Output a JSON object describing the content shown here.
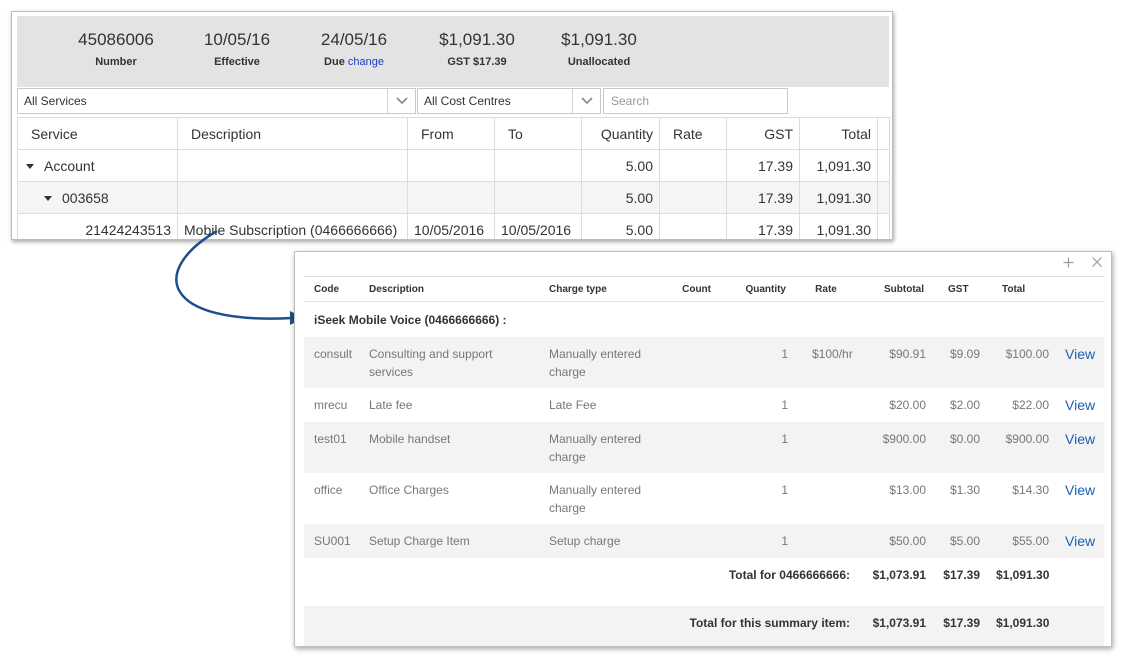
{
  "summary": {
    "number": {
      "value": "45086006",
      "label": "Number"
    },
    "effective": {
      "value": "10/05/16",
      "label": "Effective"
    },
    "due": {
      "value": "24/05/16",
      "label": "Due",
      "link": "change"
    },
    "amount": {
      "value": "$1,091.30",
      "label": "GST $17.39"
    },
    "unallocated": {
      "value": "$1,091.30",
      "label": "Unallocated"
    }
  },
  "filters": {
    "services": "All Services",
    "cost_centres": "All Cost Centres",
    "search_placeholder": "Search"
  },
  "services_table": {
    "headers": [
      "Service",
      "Description",
      "From",
      "To",
      "Quantity",
      "Rate",
      "GST",
      "Total"
    ],
    "rows": [
      {
        "service": "Account",
        "description": "",
        "from": "",
        "to": "",
        "quantity": "5.00",
        "rate": "",
        "gst": "17.39",
        "total": "1,091.30"
      },
      {
        "service": "003658",
        "description": "",
        "from": "",
        "to": "",
        "quantity": "5.00",
        "rate": "",
        "gst": "17.39",
        "total": "1,091.30"
      },
      {
        "service": "21424243513",
        "description": "Mobile Subscription (0466666666)",
        "from": "10/05/2016",
        "to": "10/05/2016",
        "quantity": "5.00",
        "rate": "",
        "gst": "17.39",
        "total": "1,091.30"
      }
    ]
  },
  "detail": {
    "headers": [
      "Code",
      "Description",
      "Charge type",
      "Count",
      "Quantity",
      "Rate",
      "Subtotal",
      "GST",
      "Total"
    ],
    "group_title": "iSeek Mobile Voice (0466666666) :",
    "rows": [
      {
        "code": "consult",
        "description": "Consulting and support services",
        "charge_type": "Manually entered charge",
        "count": "",
        "quantity": "1",
        "rate": "$100/hr",
        "subtotal": "$90.91",
        "gst": "$9.09",
        "total": "$100.00",
        "action": "View"
      },
      {
        "code": "mrecu",
        "description": "Late fee",
        "charge_type": "Late Fee",
        "count": "",
        "quantity": "1",
        "rate": "",
        "subtotal": "$20.00",
        "gst": "$2.00",
        "total": "$22.00",
        "action": "View"
      },
      {
        "code": "test01",
        "description": "Mobile handset",
        "charge_type": "Manually entered charge",
        "count": "",
        "quantity": "1",
        "rate": "",
        "subtotal": "$900.00",
        "gst": "$0.00",
        "total": "$900.00",
        "action": "View"
      },
      {
        "code": "office",
        "description": "Office Charges",
        "charge_type": "Manually entered charge",
        "count": "",
        "quantity": "1",
        "rate": "",
        "subtotal": "$13.00",
        "gst": "$1.30",
        "total": "$14.30",
        "action": "View"
      },
      {
        "code": "SU001",
        "description": "Setup Charge Item",
        "charge_type": "Setup charge",
        "count": "",
        "quantity": "1",
        "rate": "",
        "subtotal": "$50.00",
        "gst": "$5.00",
        "total": "$55.00",
        "action": "View"
      }
    ],
    "total_service": {
      "label": "Total for 0466666666:",
      "subtotal": "$1,073.91",
      "gst": "$17.39",
      "total": "$1,091.30"
    },
    "total_summary": {
      "label": "Total for this summary item:",
      "subtotal": "$1,073.91",
      "gst": "$17.39",
      "total": "$1,091.30"
    }
  },
  "icons": {
    "dropdown": "chevron-down-icon",
    "expand": "caret-down-icon",
    "maximize": "plus-icon",
    "close": "close-icon"
  },
  "colors": {
    "link": "#1a5fb4",
    "arrow": "#1f4e8c",
    "summary_band": "#e3e3e3"
  }
}
